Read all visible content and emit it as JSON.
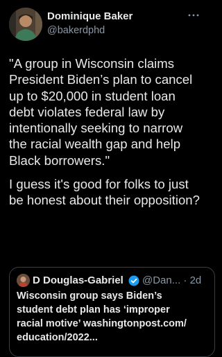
{
  "author": {
    "display_name": "Dominique Baker",
    "handle": "@bakerdphd"
  },
  "tweet": {
    "paragraphs": [
      "\"A group in Wisconsin claims President Biden’s plan to cancel up to $20,000 in student loan debt violates federal law by intentionally seeking to narrow the racial wealth gap and help Black borrowers.\"",
      "I guess it's good for folks to just be honest about their opposition?"
    ]
  },
  "quote": {
    "author_name": "D Douglas-Gabriel",
    "handle_and_time": "@Dan... · 2d",
    "text_lines": [
      "Wisconsin group says Biden’s",
      "student debt plan has ‘improper",
      "racial motive’ washingtonpost.com/",
      "education/2022..."
    ]
  },
  "colors": {
    "background": "#000000",
    "text": "#e7e9ea",
    "secondary": "#8b98a5",
    "verified": "#1d9bf0"
  }
}
